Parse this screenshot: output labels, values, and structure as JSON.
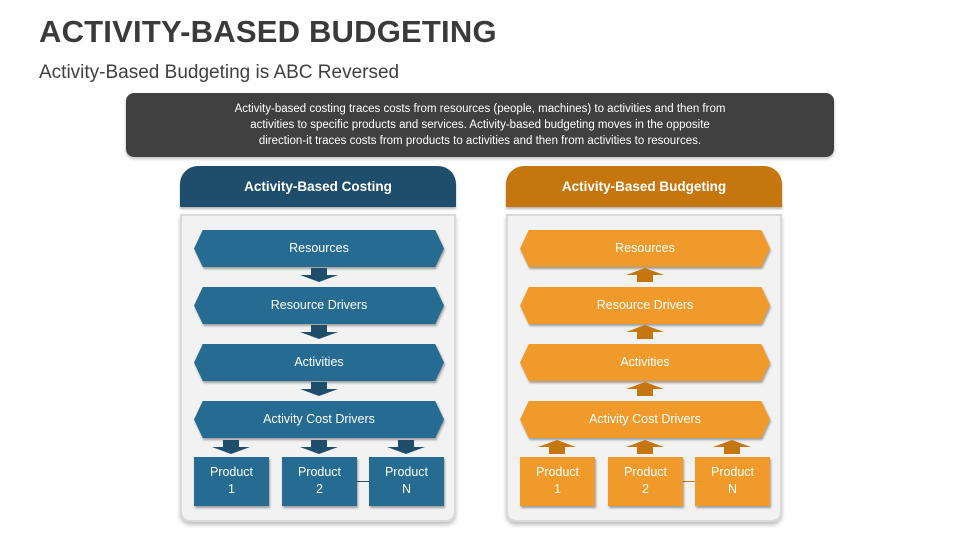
{
  "title": "ACTIVITY-BASED BUDGETING",
  "subtitle": "Activity-Based Budgeting is ABC Reversed",
  "description": {
    "line1": "Activity-based costing traces costs from resources (people, machines) to activities and then from",
    "line2": "activities to specific products and services. Activity-based budgeting moves in the opposite",
    "line3": "direction-it traces costs from products to activities and then from activities to resources."
  },
  "colors": {
    "costing_header": "#1f4e6c",
    "costing_fill": "#266b91",
    "costing_arrow": "#1f4e6c",
    "budgeting_header": "#c5760f",
    "budgeting_fill": "#f09a2b",
    "budgeting_arrow": "#c5760f",
    "description_bg": "#404040"
  },
  "panels": [
    {
      "header": "Activity-Based Costing",
      "arrow_direction": "down",
      "stages": [
        "Resources",
        "Resource Drivers",
        "Activities",
        "Activity Cost Drivers"
      ],
      "products": [
        {
          "line1": "Product",
          "line2": "1"
        },
        {
          "line1": "Product",
          "line2": "2"
        },
        {
          "line1": "Product",
          "line2": "N"
        }
      ]
    },
    {
      "header": "Activity-Based Budgeting",
      "arrow_direction": "up",
      "stages": [
        "Resources",
        "Resource Drivers",
        "Activities",
        "Activity Cost Drivers"
      ],
      "products": [
        {
          "line1": "Product",
          "line2": "1"
        },
        {
          "line1": "Product",
          "line2": "2"
        },
        {
          "line1": "Product",
          "line2": "N"
        }
      ]
    }
  ]
}
